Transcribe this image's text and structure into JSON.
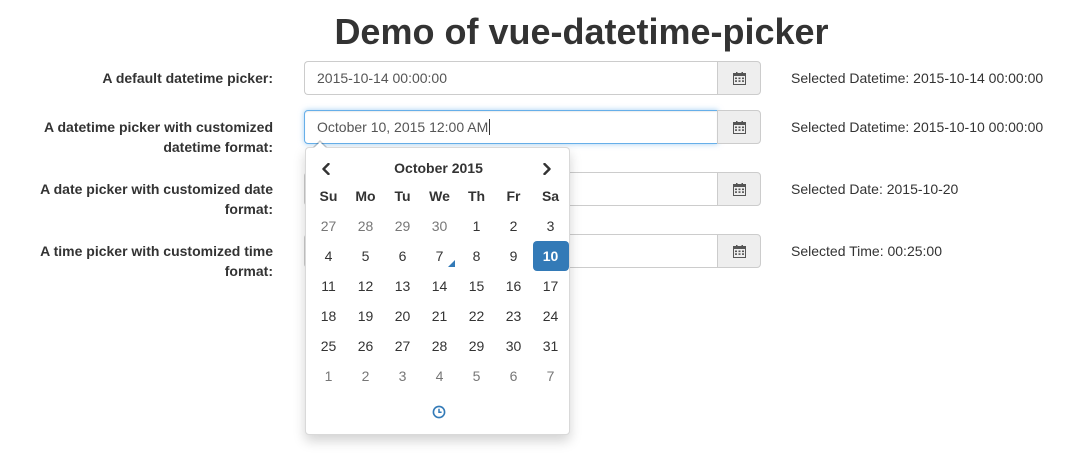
{
  "page": {
    "title": "Demo of vue-datetime-picker"
  },
  "rows": [
    {
      "label": "A default datetime picker:",
      "value": "2015-10-14 00:00:00",
      "status": "Selected Datetime: 2015-10-14 00:00:00"
    },
    {
      "label_line1": "A datetime picker with customized",
      "label_line2": "datetime format:",
      "value": "October 10, 2015 12:00 AM",
      "status": "Selected Datetime: 2015-10-10 00:00:00"
    },
    {
      "label_line1": "A date picker with customized date",
      "label_line2": "format:",
      "value": "",
      "status": "Selected Date: 2015-10-20"
    },
    {
      "label_line1": "A time picker with customized time",
      "label_line2": "format:",
      "value": "",
      "status": "Selected Time: 00:25:00"
    }
  ],
  "icons": {
    "addon": "calendar-icon",
    "prev": "chevron-left-icon",
    "next": "chevron-right-icon",
    "toggle": "clock-icon"
  },
  "colors": {
    "accent": "#337ab7",
    "focus": "#66afe9",
    "muted": "#777777"
  },
  "calendar": {
    "month_title": "October 2015",
    "weekdays": [
      "Su",
      "Mo",
      "Tu",
      "We",
      "Th",
      "Fr",
      "Sa"
    ],
    "weeks": [
      [
        {
          "d": "27",
          "t": "old"
        },
        {
          "d": "28",
          "t": "old"
        },
        {
          "d": "29",
          "t": "old"
        },
        {
          "d": "30",
          "t": "old"
        },
        {
          "d": "1",
          "t": ""
        },
        {
          "d": "2",
          "t": ""
        },
        {
          "d": "3",
          "t": ""
        }
      ],
      [
        {
          "d": "4",
          "t": ""
        },
        {
          "d": "5",
          "t": ""
        },
        {
          "d": "6",
          "t": ""
        },
        {
          "d": "7",
          "t": "today"
        },
        {
          "d": "8",
          "t": ""
        },
        {
          "d": "9",
          "t": ""
        },
        {
          "d": "10",
          "t": "active"
        }
      ],
      [
        {
          "d": "11",
          "t": ""
        },
        {
          "d": "12",
          "t": ""
        },
        {
          "d": "13",
          "t": ""
        },
        {
          "d": "14",
          "t": ""
        },
        {
          "d": "15",
          "t": ""
        },
        {
          "d": "16",
          "t": ""
        },
        {
          "d": "17",
          "t": ""
        }
      ],
      [
        {
          "d": "18",
          "t": ""
        },
        {
          "d": "19",
          "t": ""
        },
        {
          "d": "20",
          "t": ""
        },
        {
          "d": "21",
          "t": ""
        },
        {
          "d": "22",
          "t": ""
        },
        {
          "d": "23",
          "t": ""
        },
        {
          "d": "24",
          "t": ""
        }
      ],
      [
        {
          "d": "25",
          "t": ""
        },
        {
          "d": "26",
          "t": ""
        },
        {
          "d": "27",
          "t": ""
        },
        {
          "d": "28",
          "t": ""
        },
        {
          "d": "29",
          "t": ""
        },
        {
          "d": "30",
          "t": ""
        },
        {
          "d": "31",
          "t": ""
        }
      ],
      [
        {
          "d": "1",
          "t": "new"
        },
        {
          "d": "2",
          "t": "new"
        },
        {
          "d": "3",
          "t": "new"
        },
        {
          "d": "4",
          "t": "new"
        },
        {
          "d": "5",
          "t": "new"
        },
        {
          "d": "6",
          "t": "new"
        },
        {
          "d": "7",
          "t": "new"
        }
      ]
    ]
  }
}
